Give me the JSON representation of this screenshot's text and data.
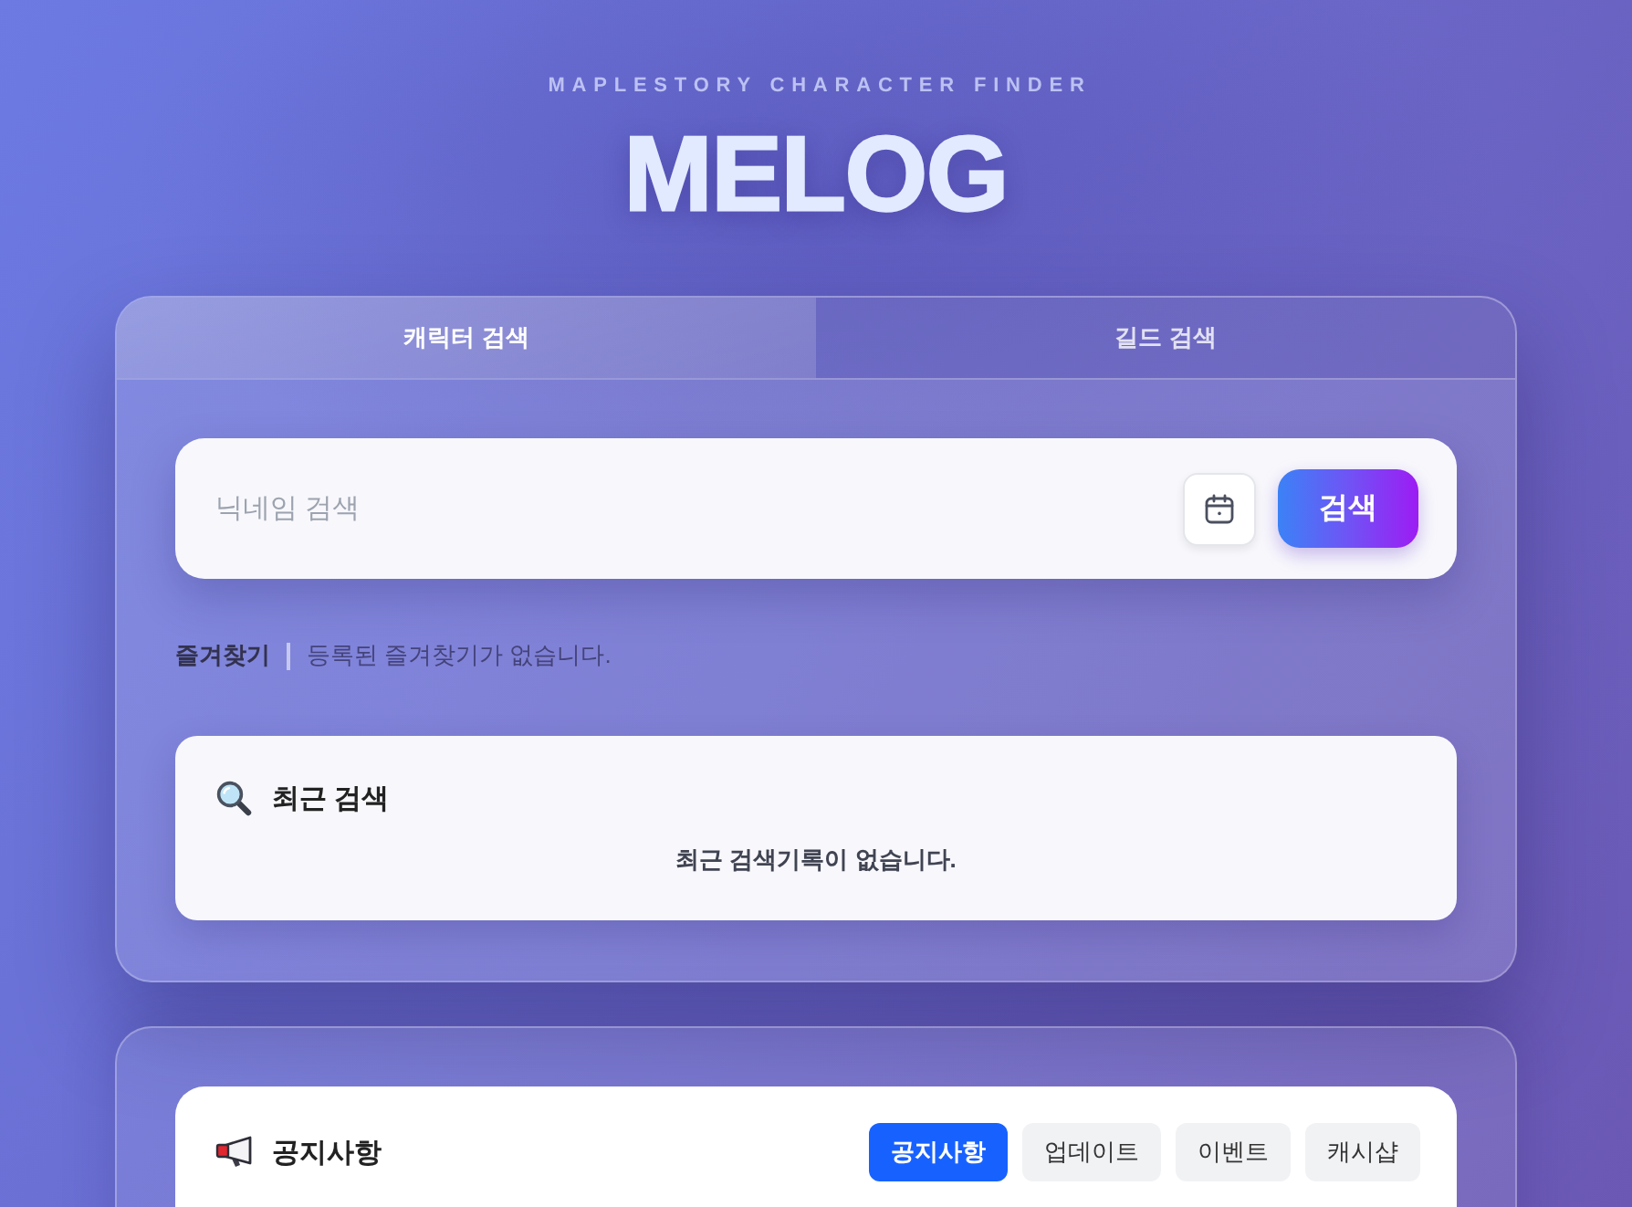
{
  "header": {
    "subtitle": "MAPLESTORY CHARACTER FINDER",
    "title": "MELOG"
  },
  "search_card": {
    "tabs": [
      {
        "label": "캐릭터 검색",
        "selected": true
      },
      {
        "label": "길드 검색",
        "selected": false
      }
    ],
    "search": {
      "placeholder": "닉네임 검색",
      "button": "검색"
    },
    "favorites": {
      "label": "즐겨찾기",
      "empty_message": "등록된 즐겨찾기가 없습니다."
    },
    "recent": {
      "title": "최근 검색",
      "empty_message": "최근 검색기록이 없습니다."
    }
  },
  "notice_card": {
    "title": "공지사항",
    "tabs": [
      {
        "label": "공지사항",
        "selected": true
      },
      {
        "label": "업데이트",
        "selected": false
      },
      {
        "label": "이벤트",
        "selected": false
      },
      {
        "label": "캐시샵",
        "selected": false
      }
    ]
  }
}
